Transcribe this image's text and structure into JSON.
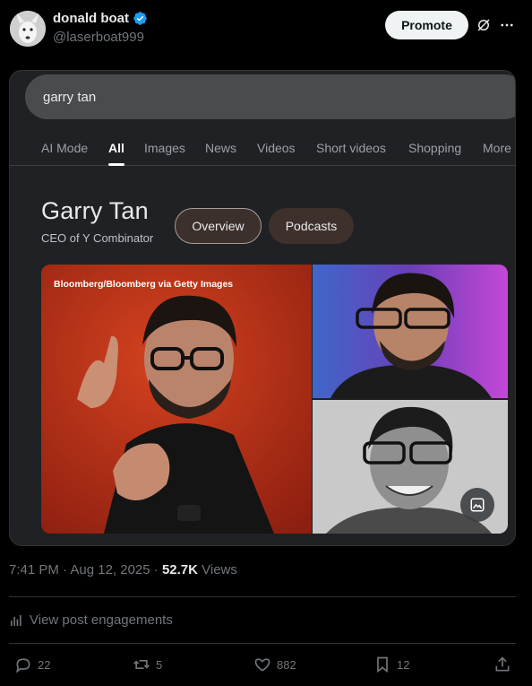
{
  "post": {
    "author_name": "donald boat",
    "author_handle": "@laserboat999",
    "verified": true,
    "promote_label": "Promote",
    "timestamp": "7:41 PM · Aug 12, 2025 · ",
    "views_count": "52.7K",
    "views_label": " Views",
    "engagements_label": "View post engagements",
    "replies": "22",
    "reposts": "5",
    "likes": "882",
    "bookmarks": "12",
    "icons": [
      "verified-badge-icon",
      "grok-icon",
      "more-icon",
      "analytics-icon",
      "reply-icon",
      "repost-icon",
      "like-icon",
      "bookmark-icon",
      "share-icon"
    ]
  },
  "embedded": {
    "search_query": "garry tan",
    "tabs": [
      "AI Mode",
      "All",
      "Images",
      "News",
      "Videos",
      "Short videos",
      "Shopping",
      "More"
    ],
    "active_tab": "All",
    "kp_title": "Garry Tan",
    "kp_subtitle": "CEO of Y Combinator",
    "chips": [
      "Overview",
      "Podcasts"
    ],
    "photo_credit": "Bloomberg/Bloomberg via Getty Images"
  },
  "colors": {
    "background": "#000000",
    "text_primary": "#e7e9ea",
    "text_secondary": "#71767b",
    "verified": "#1d9bf0",
    "google_bg": "#202124",
    "photo_red": "#c0311c"
  }
}
